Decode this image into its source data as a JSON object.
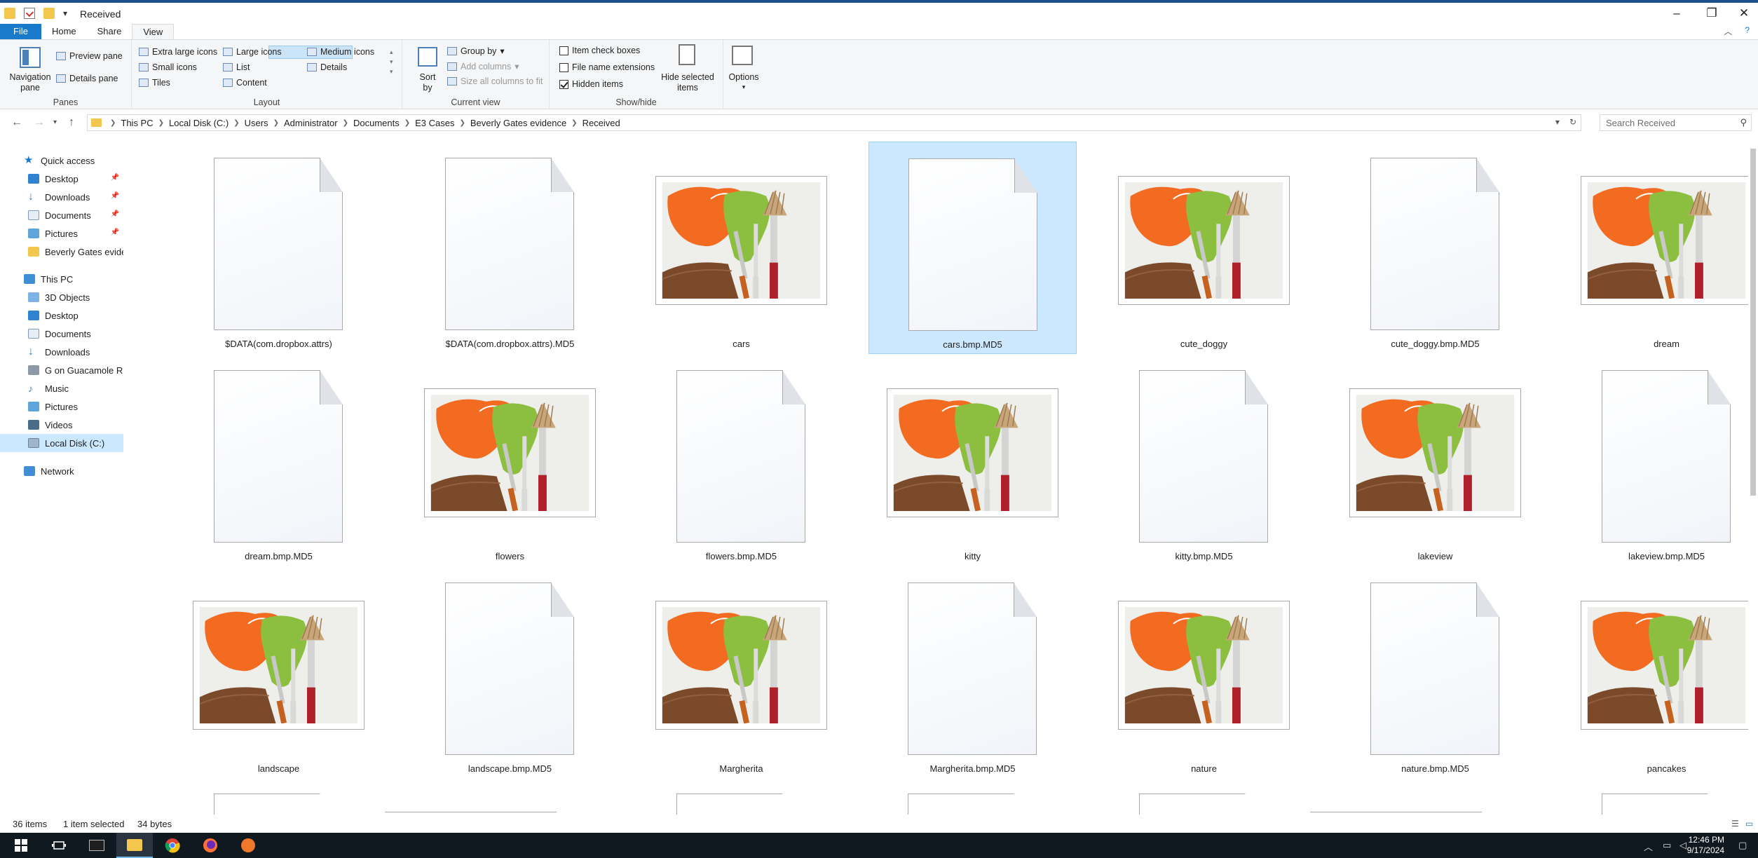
{
  "window": {
    "title": "Received"
  },
  "ribbon_tabs": [
    {
      "label": "File"
    },
    {
      "label": "Home"
    },
    {
      "label": "Share"
    },
    {
      "label": "View"
    }
  ],
  "ribbon": {
    "panes": {
      "label": "Panes",
      "navigation_pane": "Navigation\npane",
      "preview_pane": "Preview pane",
      "details_pane": "Details pane"
    },
    "layout": {
      "label": "Layout",
      "options": [
        "Extra large icons",
        "Large icons",
        "Medium icons",
        "Small icons",
        "List",
        "Details",
        "Tiles",
        "Content"
      ],
      "selected": "Extra large icons"
    },
    "current_view": {
      "label": "Current view",
      "sort_by": "Sort\nby",
      "group_by": "Group by",
      "add_columns": "Add columns",
      "size_all_columns": "Size all columns to fit"
    },
    "show_hide": {
      "label": "Show/hide",
      "item_check_boxes": {
        "label": "Item check boxes",
        "checked": false
      },
      "file_name_extensions": {
        "label": "File name extensions",
        "checked": false
      },
      "hidden_items": {
        "label": "Hidden items",
        "checked": true
      },
      "hide_selected": "Hide selected\nitems"
    },
    "options": "Options"
  },
  "address": {
    "crumbs": [
      "This PC",
      "Local Disk (C:)",
      "Users",
      "Administrator",
      "Documents",
      "E3 Cases",
      "Beverly Gates evidence",
      "Received"
    ],
    "search_placeholder": "Search Received"
  },
  "nav": {
    "quick_access": "Quick access",
    "quick_items": [
      "Desktop",
      "Downloads",
      "Documents",
      "Pictures",
      "Beverly Gates evidence"
    ],
    "this_pc": "This PC",
    "pc_items": [
      "3D Objects",
      "Desktop",
      "Documents",
      "Downloads",
      "G on Guacamole RDP",
      "Music",
      "Pictures",
      "Videos",
      "Local Disk (C:)"
    ],
    "network": "Network",
    "selected": "Local Disk (C:)"
  },
  "files": [
    {
      "name": "$DATA(com.dropbox.attrs)",
      "kind": "doc"
    },
    {
      "name": "$DATA(com.dropbox.attrs).MD5",
      "kind": "doc"
    },
    {
      "name": "cars",
      "kind": "image"
    },
    {
      "name": "cars.bmp.MD5",
      "kind": "doc",
      "selected": true
    },
    {
      "name": "cute_doggy",
      "kind": "image"
    },
    {
      "name": "cute_doggy.bmp.MD5",
      "kind": "doc"
    },
    {
      "name": "dream",
      "kind": "image"
    },
    {
      "name": "dream.bmp.MD5",
      "kind": "doc"
    },
    {
      "name": "flowers",
      "kind": "image"
    },
    {
      "name": "flowers.bmp.MD5",
      "kind": "doc"
    },
    {
      "name": "kitty",
      "kind": "image"
    },
    {
      "name": "kitty.bmp.MD5",
      "kind": "doc"
    },
    {
      "name": "lakeview",
      "kind": "image"
    },
    {
      "name": "lakeview.bmp.MD5",
      "kind": "doc"
    },
    {
      "name": "landscape",
      "kind": "image"
    },
    {
      "name": "landscape.bmp.MD5",
      "kind": "doc"
    },
    {
      "name": "Margherita",
      "kind": "image"
    },
    {
      "name": "Margherita.bmp.MD5",
      "kind": "doc"
    },
    {
      "name": "nature",
      "kind": "image"
    },
    {
      "name": "nature.bmp.MD5",
      "kind": "doc"
    },
    {
      "name": "pancakes",
      "kind": "image"
    }
  ],
  "status": {
    "item_count": "36 items",
    "selection": "1 item selected",
    "size": "34 bytes"
  },
  "taskbar": {
    "time": "12:46 PM",
    "date": "9/17/2024"
  },
  "colors": {
    "accent": "#1979ca",
    "selection": "#cce8ff",
    "taskbar": "#101820"
  }
}
